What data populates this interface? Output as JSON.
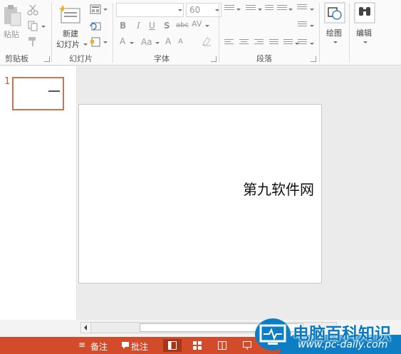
{
  "ribbon": {
    "clipboard": {
      "paste_label": "粘贴",
      "group_label": "剪贴板"
    },
    "slides": {
      "new_slide_label": "新建\n幻灯片",
      "new_line1": "新建",
      "new_line2": "幻灯片",
      "group_label": "幻灯片"
    },
    "font": {
      "font_name": "",
      "font_size": "60",
      "group_label": "字体"
    },
    "paragraph": {
      "group_label": "段落"
    },
    "drawing": {
      "label": "绘图"
    },
    "editing": {
      "label": "编辑"
    }
  },
  "thumbnails": {
    "slide_number": "1"
  },
  "slide": {
    "title": "第九软件网"
  },
  "statusbar": {
    "notes_label": "备注",
    "comments_label": "批注",
    "accent_color": "#d24b2a"
  },
  "watermark": {
    "name": "电脑百科知识",
    "url": "www.pc-daily.com",
    "color": "#0a7ac0"
  }
}
